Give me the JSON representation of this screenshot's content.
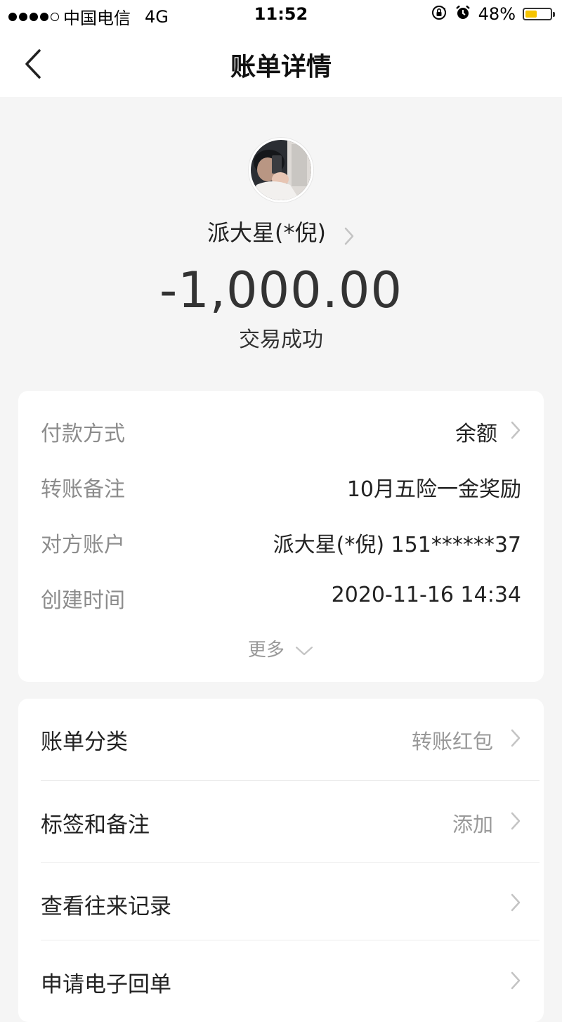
{
  "status_bar": {
    "carrier": "中国电信",
    "network": "4G",
    "time": "11:52",
    "battery_percent": "48%",
    "battery_level": 0.48,
    "signal_bars_filled": 4,
    "signal_bars_total": 5,
    "icons": [
      "signal-dots-icon",
      "rotation-lock-icon",
      "alarm-icon",
      "battery-icon"
    ]
  },
  "nav": {
    "title": "账单详情",
    "back_icon": "chevron-left-icon"
  },
  "header": {
    "payee": "派大星(*倪)",
    "amount": "-1,000.00",
    "status": "交易成功"
  },
  "details": {
    "rows": [
      {
        "label": "付款方式",
        "value": "余额"
      },
      {
        "label": "转账备注",
        "value": "10月五险一金奖励"
      },
      {
        "label": "对方账户",
        "value": "派大星(*倪) 151******37"
      },
      {
        "label": "创建时间",
        "value": "2020-11-16 14:34"
      }
    ],
    "more": "更多"
  },
  "actions": {
    "items": [
      {
        "label": "账单分类",
        "value": "转账红包"
      },
      {
        "label": "标签和备注",
        "value": "添加"
      },
      {
        "label": "查看往来记录",
        "value": ""
      },
      {
        "label": "申请电子回单",
        "value": ""
      }
    ]
  },
  "colors": {
    "background": "#f5f5f5",
    "card": "#ffffff",
    "battery": "#f6c400",
    "muted_text": "#8c8c8c"
  }
}
